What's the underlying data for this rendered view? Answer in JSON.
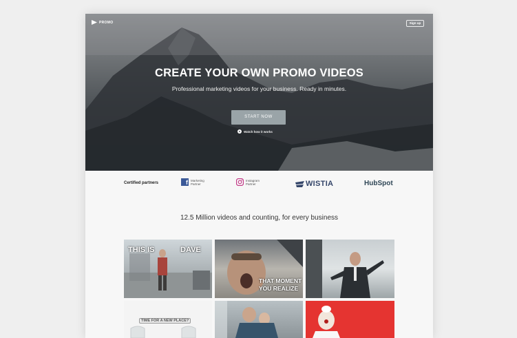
{
  "header": {
    "logo_text": "PROMO",
    "signup_label": "Sign up"
  },
  "hero": {
    "title": "CREATE YOUR OWN PROMO VIDEOS",
    "subtitle": "Professional marketing videos for your business. Ready in minutes.",
    "cta_label": "START NOW",
    "watch_label": "Watch how it works"
  },
  "partners": {
    "label": "Certified partners",
    "facebook": {
      "line1": "Marketing",
      "line2": "Partner"
    },
    "instagram": {
      "line1": "Instagram",
      "line2": "Partner"
    },
    "wistia": "WISTIA",
    "hubspot": "HubSpot"
  },
  "tagline": "12.5 Million videos and counting, for every business",
  "videos": {
    "v1_caption_a": "THIS IS",
    "v1_caption_b": "DAVE",
    "v2_caption_a": "THAT MOMENT",
    "v2_caption_b": "YOU REALIZE",
    "v4_caption": "TIME FOR A NEW PLACE?"
  },
  "colors": {
    "facebook": "#3b5998",
    "start_button": "#9aa4a8",
    "red_tile": "#e53431"
  }
}
